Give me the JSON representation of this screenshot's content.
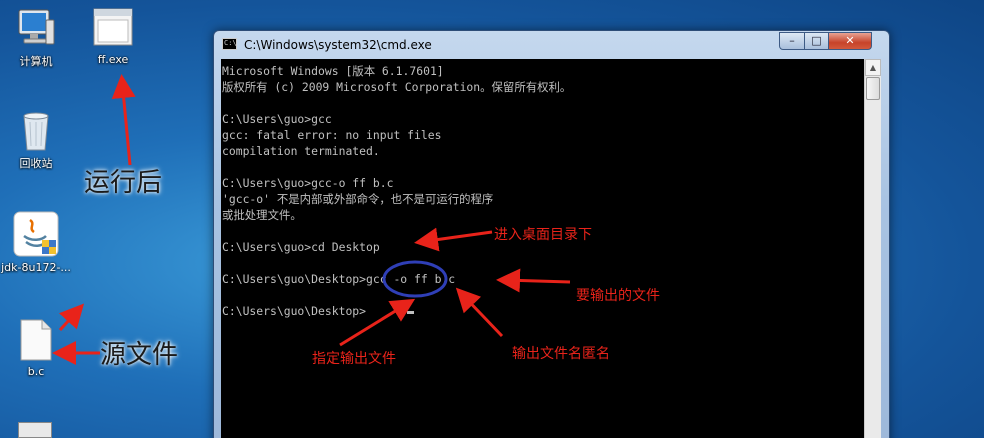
{
  "desktop": {
    "icons": [
      {
        "label": "计算机"
      },
      {
        "label": "ff.exe"
      },
      {
        "label": "回收站"
      },
      {
        "label": "jdk-8u172-..."
      },
      {
        "label": "b.c"
      }
    ]
  },
  "window": {
    "title": "C:\\Windows\\system32\\cmd.exe",
    "minimize_glyph": "–",
    "maximize_glyph": "□",
    "close_glyph": "✕"
  },
  "console": {
    "lines": [
      "Microsoft Windows [版本 6.1.7601]",
      "版权所有 (c) 2009 Microsoft Corporation。保留所有权利。",
      "",
      "C:\\Users\\guo>gcc",
      "gcc: fatal error: no input files",
      "compilation terminated.",
      "",
      "C:\\Users\\guo>gcc-o ff b.c",
      "'gcc-o' 不是内部或外部命令，也不是可运行的程序",
      "或批处理文件。",
      "",
      "C:\\Users\\guo>cd Desktop",
      "",
      "C:\\Users\\guo\\Desktop>gcc -o ff b.c",
      "",
      "C:\\Users\\guo\\Desktop>"
    ]
  },
  "annotations": {
    "after_run": "运行后",
    "source_file": "源文件",
    "enter_desktop": "进入桌面目录下",
    "output_file": "要输出的文件",
    "specify_output": "指定输出文件",
    "output_filename": "输出文件名匿名"
  },
  "colors": {
    "annotation_red": "#e8231a",
    "circle_blue": "#2f3fb7",
    "console_text": "#c0c0c0",
    "console_bg": "#000000"
  }
}
